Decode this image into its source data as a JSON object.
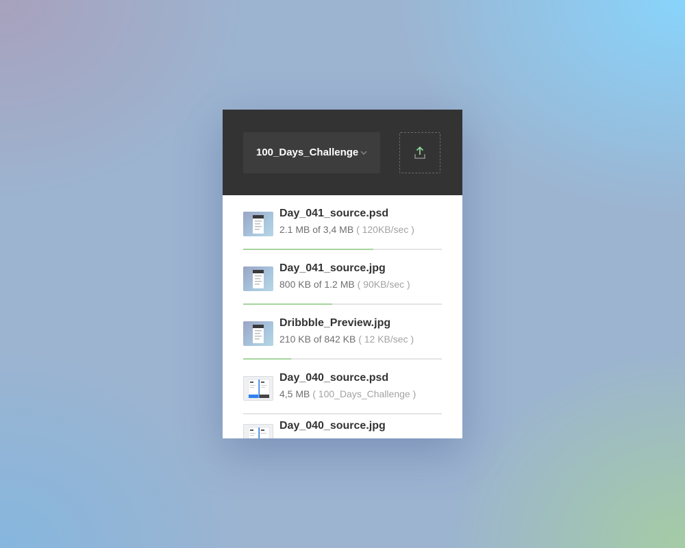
{
  "header": {
    "folder_name": "100_Days_Challenge",
    "chevron_icon": "chevron-down-icon",
    "upload_icon": "upload-icon",
    "upload_icon_color": "#8fd39a"
  },
  "colors": {
    "header_bg": "#333333",
    "progress_fill": "#a6d49e",
    "progress_track": "#e4e4e4"
  },
  "files": [
    {
      "name": "Day_041_source.psd",
      "size_text": "2.1 MB of 3,4 MB",
      "sub_text": "( 120KB/sec )",
      "progress": 0.655,
      "thumbnail": "document-thumbnail"
    },
    {
      "name": "Day_041_source.jpg",
      "size_text": "800 KB of 1.2 MB",
      "sub_text": "( 90KB/sec )",
      "progress": 0.448,
      "thumbnail": "document-thumbnail"
    },
    {
      "name": "Dribbble_Preview.jpg",
      "size_text": "210 KB of 842 KB",
      "sub_text": "( 12 KB/sec )",
      "progress": 0.241,
      "thumbnail": "document-thumbnail"
    },
    {
      "name": "Day_040_source.psd",
      "size_text": "4,5 MB",
      "sub_text": "( 100_Days_Challenge )",
      "progress": 0,
      "thumbnail": "app-screens-thumbnail"
    },
    {
      "name": "Day_040_source.jpg",
      "size_text": "",
      "sub_text": "",
      "progress": 0,
      "thumbnail": "app-screens-thumbnail"
    }
  ]
}
